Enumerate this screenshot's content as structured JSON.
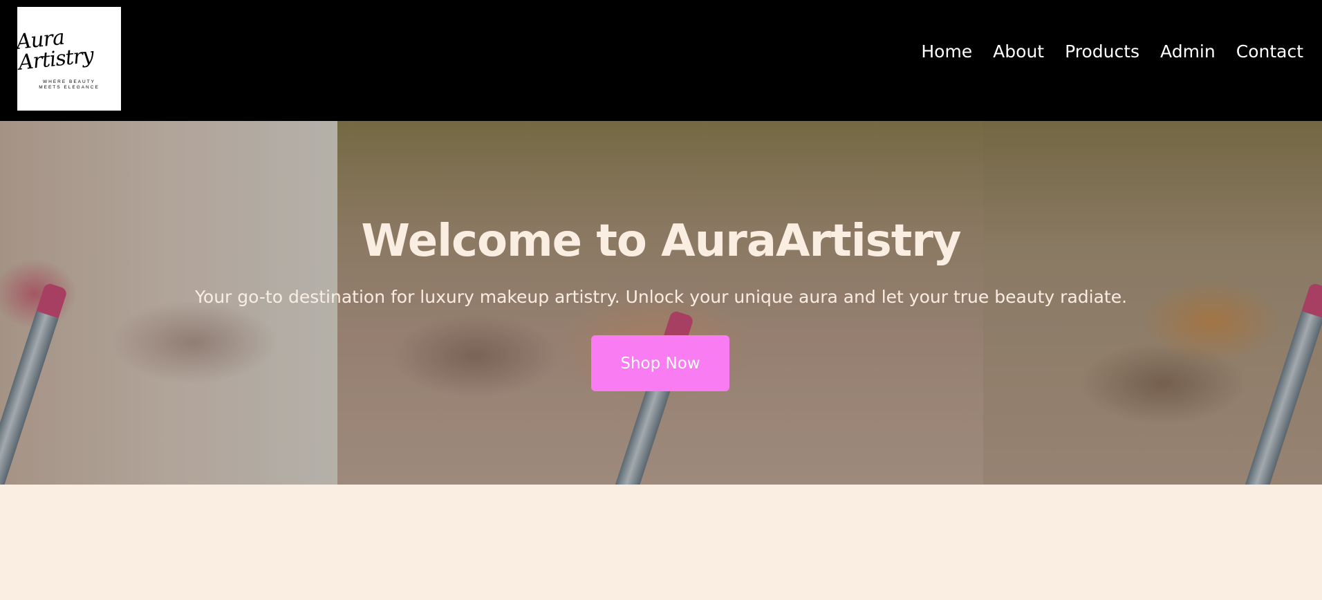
{
  "header": {
    "logo": {
      "script": "Aura Artistry",
      "tagline": "WHERE BEAUTY MEETS ELEGANCE"
    },
    "nav": [
      {
        "label": "Home"
      },
      {
        "label": "About"
      },
      {
        "label": "Products"
      },
      {
        "label": "Admin"
      },
      {
        "label": "Contact"
      }
    ]
  },
  "hero": {
    "title": "Welcome to AuraArtistry",
    "subtitle": "Your go-to destination for luxury makeup artistry. Unlock your unique aura and let your true beauty radiate.",
    "cta_label": "Shop Now",
    "image": "makeup-application-photo"
  },
  "colors": {
    "header_bg": "#000000",
    "page_bg": "#faeee3",
    "hero_text": "#faeee3",
    "cta_bg": "#f97cf3",
    "cta_text": "#ffffff"
  }
}
